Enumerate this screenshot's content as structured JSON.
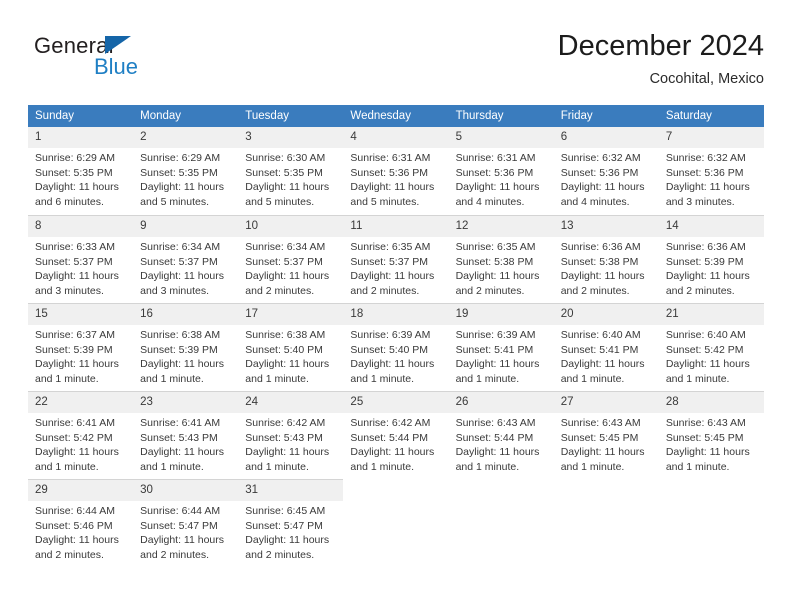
{
  "brand": {
    "name_part1": "General",
    "name_part2": "Blue"
  },
  "header": {
    "title": "December 2024",
    "subtitle": "Cocohital, Mexico"
  },
  "calendar": {
    "weekday_headers": [
      "Sunday",
      "Monday",
      "Tuesday",
      "Wednesday",
      "Thursday",
      "Friday",
      "Saturday"
    ],
    "accent_color": "#3a7cbe",
    "daynum_bg": "#f0f0f0",
    "weeks": [
      [
        {
          "day": "1",
          "sunrise": "Sunrise: 6:29 AM",
          "sunset": "Sunset: 5:35 PM",
          "daylight1": "Daylight: 11 hours",
          "daylight2": "and 6 minutes."
        },
        {
          "day": "2",
          "sunrise": "Sunrise: 6:29 AM",
          "sunset": "Sunset: 5:35 PM",
          "daylight1": "Daylight: 11 hours",
          "daylight2": "and 5 minutes."
        },
        {
          "day": "3",
          "sunrise": "Sunrise: 6:30 AM",
          "sunset": "Sunset: 5:35 PM",
          "daylight1": "Daylight: 11 hours",
          "daylight2": "and 5 minutes."
        },
        {
          "day": "4",
          "sunrise": "Sunrise: 6:31 AM",
          "sunset": "Sunset: 5:36 PM",
          "daylight1": "Daylight: 11 hours",
          "daylight2": "and 5 minutes."
        },
        {
          "day": "5",
          "sunrise": "Sunrise: 6:31 AM",
          "sunset": "Sunset: 5:36 PM",
          "daylight1": "Daylight: 11 hours",
          "daylight2": "and 4 minutes."
        },
        {
          "day": "6",
          "sunrise": "Sunrise: 6:32 AM",
          "sunset": "Sunset: 5:36 PM",
          "daylight1": "Daylight: 11 hours",
          "daylight2": "and 4 minutes."
        },
        {
          "day": "7",
          "sunrise": "Sunrise: 6:32 AM",
          "sunset": "Sunset: 5:36 PM",
          "daylight1": "Daylight: 11 hours",
          "daylight2": "and 3 minutes."
        }
      ],
      [
        {
          "day": "8",
          "sunrise": "Sunrise: 6:33 AM",
          "sunset": "Sunset: 5:37 PM",
          "daylight1": "Daylight: 11 hours",
          "daylight2": "and 3 minutes."
        },
        {
          "day": "9",
          "sunrise": "Sunrise: 6:34 AM",
          "sunset": "Sunset: 5:37 PM",
          "daylight1": "Daylight: 11 hours",
          "daylight2": "and 3 minutes."
        },
        {
          "day": "10",
          "sunrise": "Sunrise: 6:34 AM",
          "sunset": "Sunset: 5:37 PM",
          "daylight1": "Daylight: 11 hours",
          "daylight2": "and 2 minutes."
        },
        {
          "day": "11",
          "sunrise": "Sunrise: 6:35 AM",
          "sunset": "Sunset: 5:37 PM",
          "daylight1": "Daylight: 11 hours",
          "daylight2": "and 2 minutes."
        },
        {
          "day": "12",
          "sunrise": "Sunrise: 6:35 AM",
          "sunset": "Sunset: 5:38 PM",
          "daylight1": "Daylight: 11 hours",
          "daylight2": "and 2 minutes."
        },
        {
          "day": "13",
          "sunrise": "Sunrise: 6:36 AM",
          "sunset": "Sunset: 5:38 PM",
          "daylight1": "Daylight: 11 hours",
          "daylight2": "and 2 minutes."
        },
        {
          "day": "14",
          "sunrise": "Sunrise: 6:36 AM",
          "sunset": "Sunset: 5:39 PM",
          "daylight1": "Daylight: 11 hours",
          "daylight2": "and 2 minutes."
        }
      ],
      [
        {
          "day": "15",
          "sunrise": "Sunrise: 6:37 AM",
          "sunset": "Sunset: 5:39 PM",
          "daylight1": "Daylight: 11 hours",
          "daylight2": "and 1 minute."
        },
        {
          "day": "16",
          "sunrise": "Sunrise: 6:38 AM",
          "sunset": "Sunset: 5:39 PM",
          "daylight1": "Daylight: 11 hours",
          "daylight2": "and 1 minute."
        },
        {
          "day": "17",
          "sunrise": "Sunrise: 6:38 AM",
          "sunset": "Sunset: 5:40 PM",
          "daylight1": "Daylight: 11 hours",
          "daylight2": "and 1 minute."
        },
        {
          "day": "18",
          "sunrise": "Sunrise: 6:39 AM",
          "sunset": "Sunset: 5:40 PM",
          "daylight1": "Daylight: 11 hours",
          "daylight2": "and 1 minute."
        },
        {
          "day": "19",
          "sunrise": "Sunrise: 6:39 AM",
          "sunset": "Sunset: 5:41 PM",
          "daylight1": "Daylight: 11 hours",
          "daylight2": "and 1 minute."
        },
        {
          "day": "20",
          "sunrise": "Sunrise: 6:40 AM",
          "sunset": "Sunset: 5:41 PM",
          "daylight1": "Daylight: 11 hours",
          "daylight2": "and 1 minute."
        },
        {
          "day": "21",
          "sunrise": "Sunrise: 6:40 AM",
          "sunset": "Sunset: 5:42 PM",
          "daylight1": "Daylight: 11 hours",
          "daylight2": "and 1 minute."
        }
      ],
      [
        {
          "day": "22",
          "sunrise": "Sunrise: 6:41 AM",
          "sunset": "Sunset: 5:42 PM",
          "daylight1": "Daylight: 11 hours",
          "daylight2": "and 1 minute."
        },
        {
          "day": "23",
          "sunrise": "Sunrise: 6:41 AM",
          "sunset": "Sunset: 5:43 PM",
          "daylight1": "Daylight: 11 hours",
          "daylight2": "and 1 minute."
        },
        {
          "day": "24",
          "sunrise": "Sunrise: 6:42 AM",
          "sunset": "Sunset: 5:43 PM",
          "daylight1": "Daylight: 11 hours",
          "daylight2": "and 1 minute."
        },
        {
          "day": "25",
          "sunrise": "Sunrise: 6:42 AM",
          "sunset": "Sunset: 5:44 PM",
          "daylight1": "Daylight: 11 hours",
          "daylight2": "and 1 minute."
        },
        {
          "day": "26",
          "sunrise": "Sunrise: 6:43 AM",
          "sunset": "Sunset: 5:44 PM",
          "daylight1": "Daylight: 11 hours",
          "daylight2": "and 1 minute."
        },
        {
          "day": "27",
          "sunrise": "Sunrise: 6:43 AM",
          "sunset": "Sunset: 5:45 PM",
          "daylight1": "Daylight: 11 hours",
          "daylight2": "and 1 minute."
        },
        {
          "day": "28",
          "sunrise": "Sunrise: 6:43 AM",
          "sunset": "Sunset: 5:45 PM",
          "daylight1": "Daylight: 11 hours",
          "daylight2": "and 1 minute."
        }
      ],
      [
        {
          "day": "29",
          "sunrise": "Sunrise: 6:44 AM",
          "sunset": "Sunset: 5:46 PM",
          "daylight1": "Daylight: 11 hours",
          "daylight2": "and 2 minutes."
        },
        {
          "day": "30",
          "sunrise": "Sunrise: 6:44 AM",
          "sunset": "Sunset: 5:47 PM",
          "daylight1": "Daylight: 11 hours",
          "daylight2": "and 2 minutes."
        },
        {
          "day": "31",
          "sunrise": "Sunrise: 6:45 AM",
          "sunset": "Sunset: 5:47 PM",
          "daylight1": "Daylight: 11 hours",
          "daylight2": "and 2 minutes."
        },
        null,
        null,
        null,
        null
      ]
    ]
  }
}
